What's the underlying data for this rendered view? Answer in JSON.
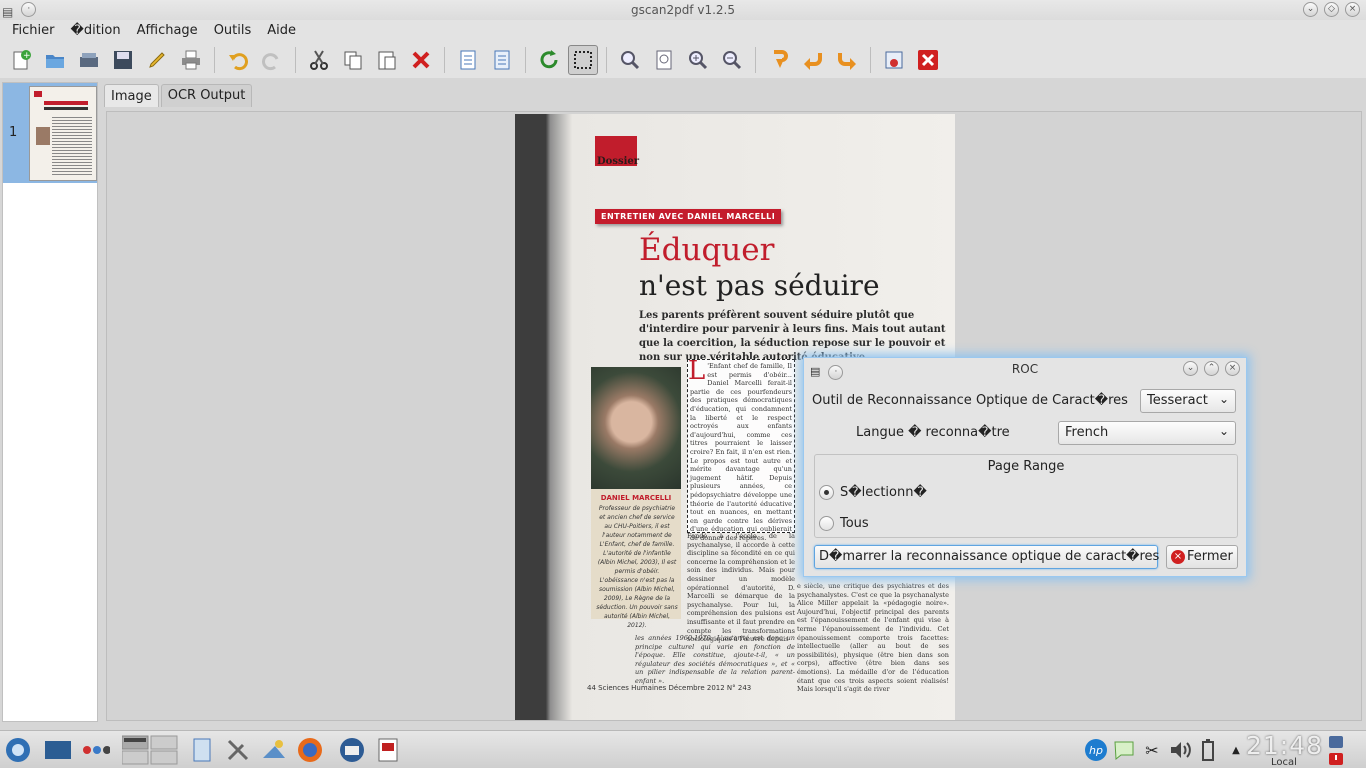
{
  "window": {
    "title": "gscan2pdf v1.2.5"
  },
  "menu": [
    "Fichier",
    "�dition",
    "Affichage",
    "Outils",
    "Aide"
  ],
  "toolbar": [
    {
      "name": "new-icon"
    },
    {
      "name": "open-icon"
    },
    {
      "name": "scan-icon"
    },
    {
      "name": "save-icon"
    },
    {
      "name": "email-icon"
    },
    {
      "name": "print-icon"
    },
    {
      "name": "undo-icon"
    },
    {
      "name": "redo-icon"
    },
    {
      "name": "cut-icon"
    },
    {
      "name": "copy-icon"
    },
    {
      "name": "paste-icon"
    },
    {
      "name": "delete-icon"
    },
    {
      "name": "renumber-icon"
    },
    {
      "name": "select-all-icon"
    },
    {
      "name": "refresh-icon"
    },
    {
      "name": "select-region-icon"
    },
    {
      "name": "zoom-100-icon"
    },
    {
      "name": "zoom-fit-icon"
    },
    {
      "name": "zoom-in-icon"
    },
    {
      "name": "zoom-out-icon"
    },
    {
      "name": "rotate-180-icon"
    },
    {
      "name": "rotate-left-icon"
    },
    {
      "name": "rotate-right-icon"
    },
    {
      "name": "properties-icon"
    },
    {
      "name": "quit-icon"
    }
  ],
  "thumbnails": [
    {
      "number": "1"
    }
  ],
  "tabs": [
    "Image",
    "OCR Output"
  ],
  "document": {
    "section": "Dossier",
    "banner": "ENTRETIEN AVEC DANIEL MARCELLI",
    "title_line1": "Éduquer",
    "title_line2": "n'est pas séduire",
    "lede": "Les parents préfèrent souvent séduire plutôt que d'interdire pour parvenir à leurs fins. Mais tout autant que la coercition, la séduction repose sur le pouvoir et non sur une véritable autorité éducative.",
    "caption_name": "DANIEL MARCELLI",
    "caption_text": "Professeur de psychiatrie et ancien chef de service au CHU-Poitiers, il est l'auteur notamment de L'Enfant, chef de famille. L'autorité de l'infantile (Albin Michel, 2003), Il est permis d'obéir. L'obéissance n'est pas la soumission (Albin Michel, 2009), Le Règne de la séduction. Un pouvoir sans autorité (Albin Michel, 2012).",
    "selected_text": "'Enfant chef de famille, Il est permis d'obéir... Daniel Marcelli ferait-il partie de ces pourfendeurs des pratiques démocratiques d'éducation, qui condamnent la liberté et le respect octroyés aux enfants d'aujourd'hui, comme ces titres pourraient le laisser croire? En fait, il n'en est rien. Le propos est tout autre et mérite davantage qu'un jugement hâtif. Depuis plusieurs années, ce pédopsychiatre développe une théorie de l'autorité éducative tout en nuances, en mettant en garde contre les dérives d'une éducation qui oublierait de donner des repères.",
    "col_mid": "Fondé à l'école de la psychanalyse, il accorde à cette discipline sa fécondité en ce qui concerne la compréhension et le soin des individus. Mais pour dessiner un modèle opérationnel d'autorité, D. Marcelli se démarque de la psychanalyse. Pour lui, la compréhension des pulsions est insuffisante et il faut prendre en compte les transformations sociologiques à l'œuvre depuis",
    "col_bottom": "les années 1960-1970. L'autorité est donc un principe culturel qui varie en fonction de l'époque. Elle constitue, ajoute-t-il, « un régulateur des sociétés démocratiques », et « un pilier indispensable de la relation parent-enfant ».",
    "col_right": "e siècle, une critique des psychiatres et des psychanalystes. C'est ce que la psychanalyste Alice Miller appelait la «pédagogie noire». Aujourd'hui, l'objectif principal des parents est l'épanouissement de l'enfant qui vise à terme l'épanouissement de l'individu. Cet épanouissement comporte trois facettes: intellectuelle (aller au bout de ses possibilités), physique (être bien dans son corps), affective (être bien dans ses émotions). La médaille d'or de l'éducation étant que ces trois aspects soient réalisés! Mais lorsqu'il s'agit de river",
    "footer": "44 Sciences Humaines  Décembre 2012 N° 243"
  },
  "dialog": {
    "title": "ROC",
    "ocr_tool_label": "Outil de Reconnaissance Optique de Caract�res",
    "ocr_tool_value": "Tesseract",
    "language_label": "Langue � reconna�tre",
    "language_value": "French",
    "page_range_title": "Page Range",
    "radio_selected": "S�lectionn�",
    "radio_all": "Tous",
    "start_button": "D�marrer la reconnaissance optique de caract�res",
    "close_button": "Fermer"
  },
  "taskbar": {
    "clock": "21:48",
    "clock_sub": "Local"
  }
}
